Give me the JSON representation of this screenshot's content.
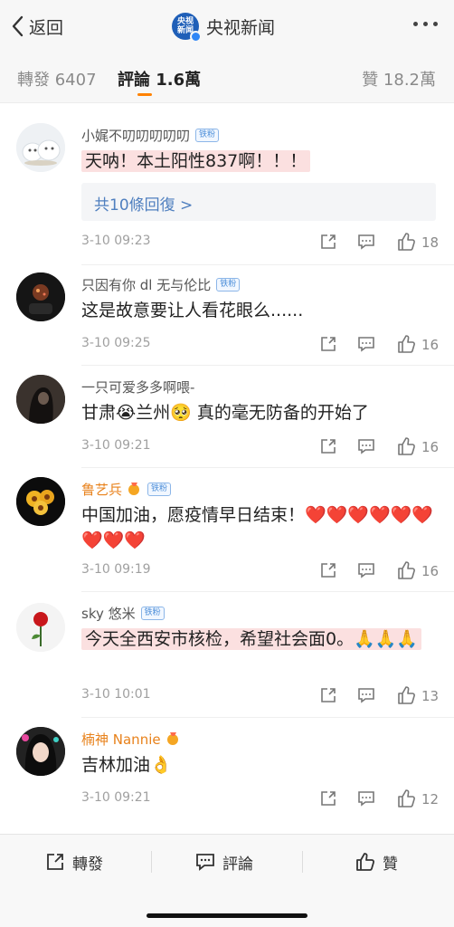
{
  "nav": {
    "back_label": "返回",
    "account_name": "央视新闻",
    "logo_text": "央视新闻"
  },
  "tabs": {
    "repost": "轉發 6407",
    "comment": "評論 1.6萬",
    "like": "贊 18.2萬",
    "active_color": "#ff8200"
  },
  "comments": [
    {
      "user": "小娓不叨叨叨叨叨",
      "badge": "铁粉",
      "text": "天呐！本土阳性837啊！！！",
      "replies": "共10條回復 >",
      "time": "3-10 09:23",
      "likes": "18"
    },
    {
      "user": "只因有你 dl 无与伦比",
      "badge": "铁粉",
      "text": "这是故意要让人看花眼么......",
      "time": "3-10 09:25",
      "likes": "16"
    },
    {
      "user": "一只可爱多多啊喂-",
      "text": "甘肃😭兰州🥺 真的毫无防备的开始了",
      "time": "3-10 09:21",
      "likes": "16"
    },
    {
      "user": "鲁艺兵",
      "badge": "铁粉",
      "text": "中国加油，愿疫情早日结束！❤️❤️❤️❤️❤️❤️❤️❤️❤️",
      "time": "3-10 09:19",
      "likes": "16"
    },
    {
      "user": "sky 悠米",
      "badge": "铁粉",
      "text": "今天全西安市核检，希望社会面0。🙏🙏🙏",
      "time": "3-10 10:01",
      "likes": "13"
    },
    {
      "user": "楠神 Nannie",
      "text": "吉林加油👌",
      "time": "3-10 09:21",
      "likes": "12"
    }
  ],
  "bottom": {
    "repost": "轉發",
    "comment": "評論",
    "like": "贊"
  },
  "colors": {
    "link_blue": "#4f7fbf",
    "orange_name": "#e8821c",
    "highlight_pink": "#fbe0e0"
  }
}
